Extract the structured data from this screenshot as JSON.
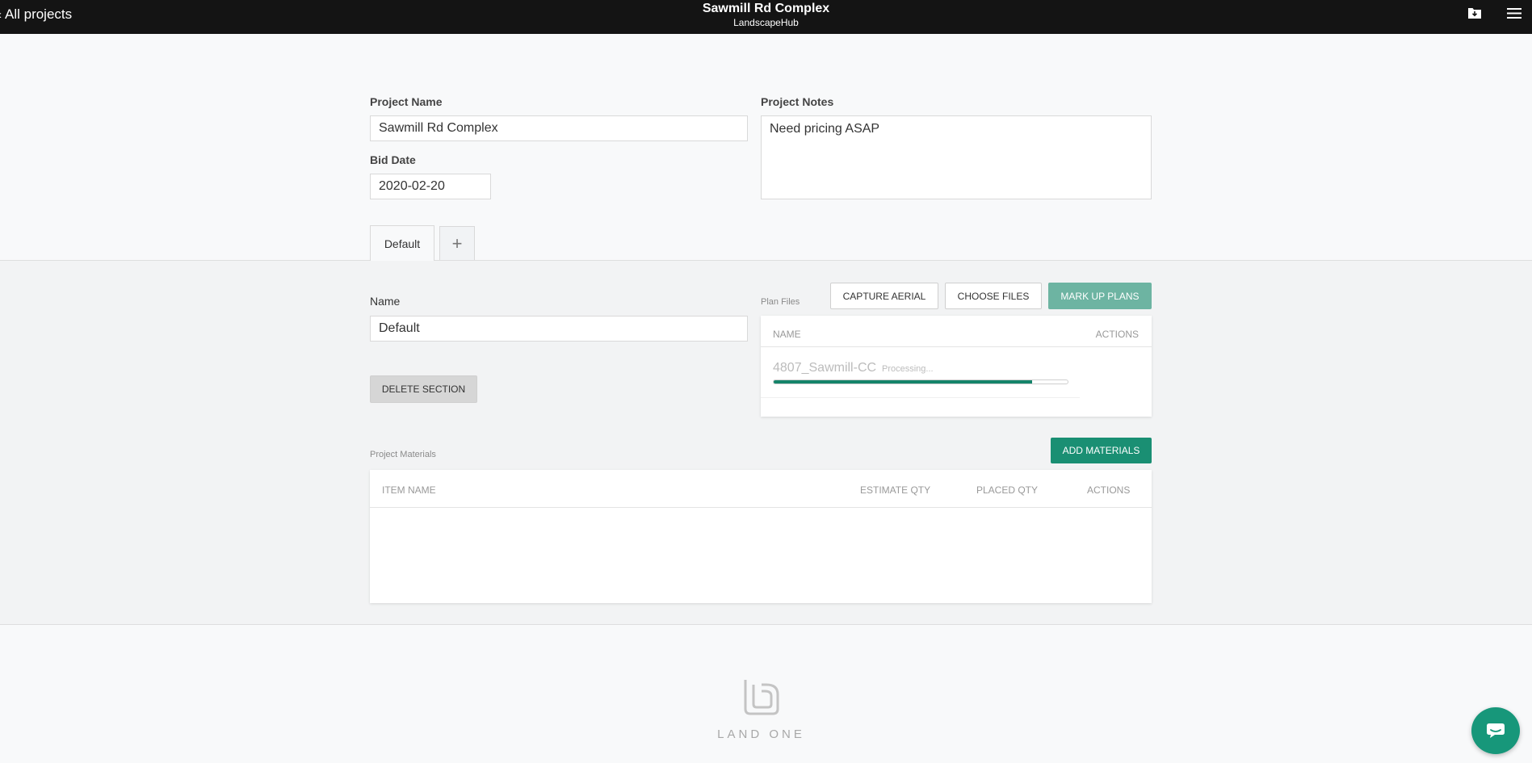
{
  "topbar": {
    "back_label": "All projects",
    "back_chevron": "‹",
    "title": "Sawmill Rd Complex",
    "subtitle": "LandscapeHub",
    "icons": [
      "download-folder-icon",
      "hamburger-menu-icon"
    ]
  },
  "project": {
    "name_label": "Project Name",
    "name_value": "Sawmill Rd Complex",
    "bid_date_label": "Bid Date",
    "bid_date_value": "2020-02-20",
    "notes_label": "Project Notes",
    "notes_value": "Need pricing ASAP"
  },
  "tabs": {
    "items": [
      {
        "label": "Default",
        "active": true
      }
    ],
    "add_label": "+"
  },
  "section": {
    "name_label": "Name",
    "name_value": "Default",
    "delete_label": "DELETE SECTION"
  },
  "plan_files": {
    "label": "Plan Files",
    "buttons": {
      "capture_aerial": "CAPTURE AERIAL",
      "choose_files": "CHOOSE FILES",
      "mark_up_plans": "MARK UP PLANS"
    },
    "columns": {
      "name": "NAME",
      "actions": "ACTIONS"
    },
    "rows": [
      {
        "name": "4807_Sawmill-CC",
        "status": "Processing...",
        "progress": 0.88
      }
    ]
  },
  "materials": {
    "label": "Project Materials",
    "add_label": "ADD MATERIALS",
    "columns": {
      "item_name": "ITEM NAME",
      "estimate_qty": "ESTIMATE QTY",
      "placed_qty": "PLACED QTY",
      "actions": "ACTIONS"
    },
    "rows": []
  },
  "footer": {
    "logo_text": "LAND ONE"
  },
  "colors": {
    "accent": "#1a8f73",
    "accent_light": "#6db4a2",
    "topbar_bg": "#141414"
  }
}
